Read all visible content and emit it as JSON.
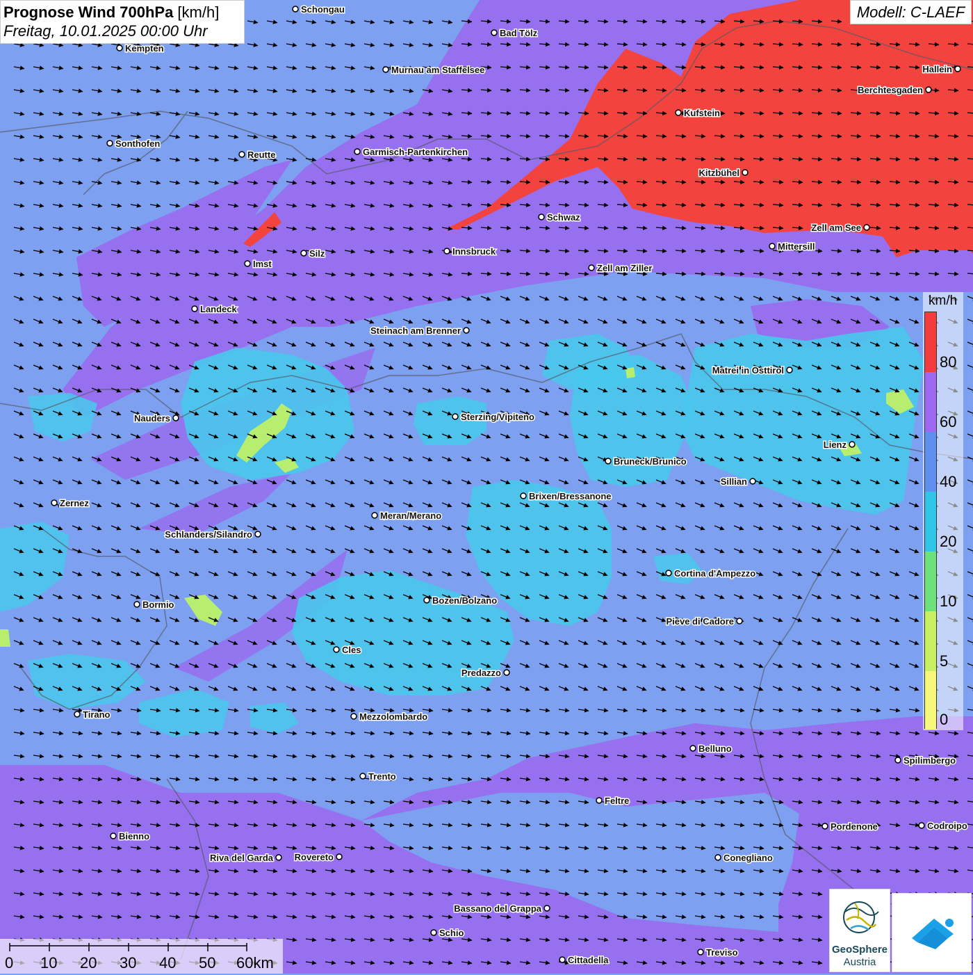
{
  "header": {
    "title_bold": "Prognose Wind 700hPa",
    "title_unit": " [km/h]",
    "datetime": "Freitag, 10.01.2025 00:00 Uhr"
  },
  "model_label": "Modell: C-LAEF",
  "legend": {
    "unit": "km/h",
    "labels": [
      "80",
      "60",
      "40",
      "20",
      "10",
      "5",
      "0"
    ],
    "colors": {
      "red": "#f53c3c",
      "purple": "#9f68f2",
      "blue": "#5f8ff0",
      "cyan": "#2fc6e8",
      "green": "#6ce37a",
      "lime": "#c8f060",
      "yellow": "#f7f77a"
    }
  },
  "scale": {
    "labels": [
      "0",
      "10",
      "20",
      "30",
      "40",
      "50",
      "60km"
    ]
  },
  "map_colors": {
    "base_blue": "#7da0f0",
    "purple_band": "#9670ee",
    "red_zone": "#f2433f",
    "cyan_zone": "#49c8ec",
    "border_line": "#555a66"
  },
  "cities": [
    {
      "name": "Schongau"
    },
    {
      "name": "Kempten"
    },
    {
      "name": "Bad Tölz"
    },
    {
      "name": "Murnau am Staffelsee"
    },
    {
      "name": "Hallein"
    },
    {
      "name": "Berchtesgaden"
    },
    {
      "name": "Kufstein"
    },
    {
      "name": "Sonthofen"
    },
    {
      "name": "Reutte"
    },
    {
      "name": "Garmisch-Partenkirchen"
    },
    {
      "name": "Kitzbühel"
    },
    {
      "name": "Schwaz"
    },
    {
      "name": "Zell am See"
    },
    {
      "name": "Mittersill"
    },
    {
      "name": "Silz"
    },
    {
      "name": "Innsbruck"
    },
    {
      "name": "Imst"
    },
    {
      "name": "Zell am Ziller"
    },
    {
      "name": "Landeck"
    },
    {
      "name": "Steinach am Brenner"
    },
    {
      "name": "Matrei in Osttirol"
    },
    {
      "name": "Nauders"
    },
    {
      "name": "Sterzing/Vipiteno"
    },
    {
      "name": "Lienz"
    },
    {
      "name": "Bruneck/Brunico"
    },
    {
      "name": "Sillian"
    },
    {
      "name": "Brixen/Bressanone"
    },
    {
      "name": "Zernez"
    },
    {
      "name": "Meran/Merano"
    },
    {
      "name": "Schlanders/Silandro"
    },
    {
      "name": "Cortina d'Ampezzo"
    },
    {
      "name": "Bozen/Bolzano"
    },
    {
      "name": "Bormio"
    },
    {
      "name": "Pieve di Cadore"
    },
    {
      "name": "Cles"
    },
    {
      "name": "Predazzo"
    },
    {
      "name": "Tirano"
    },
    {
      "name": "Mezzolombardo"
    },
    {
      "name": "Belluno"
    },
    {
      "name": "Spilimbergo"
    },
    {
      "name": "Trento"
    },
    {
      "name": "Feltre"
    },
    {
      "name": "Pordenone"
    },
    {
      "name": "Codroipo"
    },
    {
      "name": "Bienno"
    },
    {
      "name": "Riva del Garda"
    },
    {
      "name": "Rovereto"
    },
    {
      "name": "Conegliano"
    },
    {
      "name": "Bassano del Grappa"
    },
    {
      "name": "Schio"
    },
    {
      "name": "Treviso"
    },
    {
      "name": "Cittadella"
    }
  ],
  "logos": {
    "geosphere_line1": "GeoSphere",
    "geosphere_line2": "Austria"
  }
}
